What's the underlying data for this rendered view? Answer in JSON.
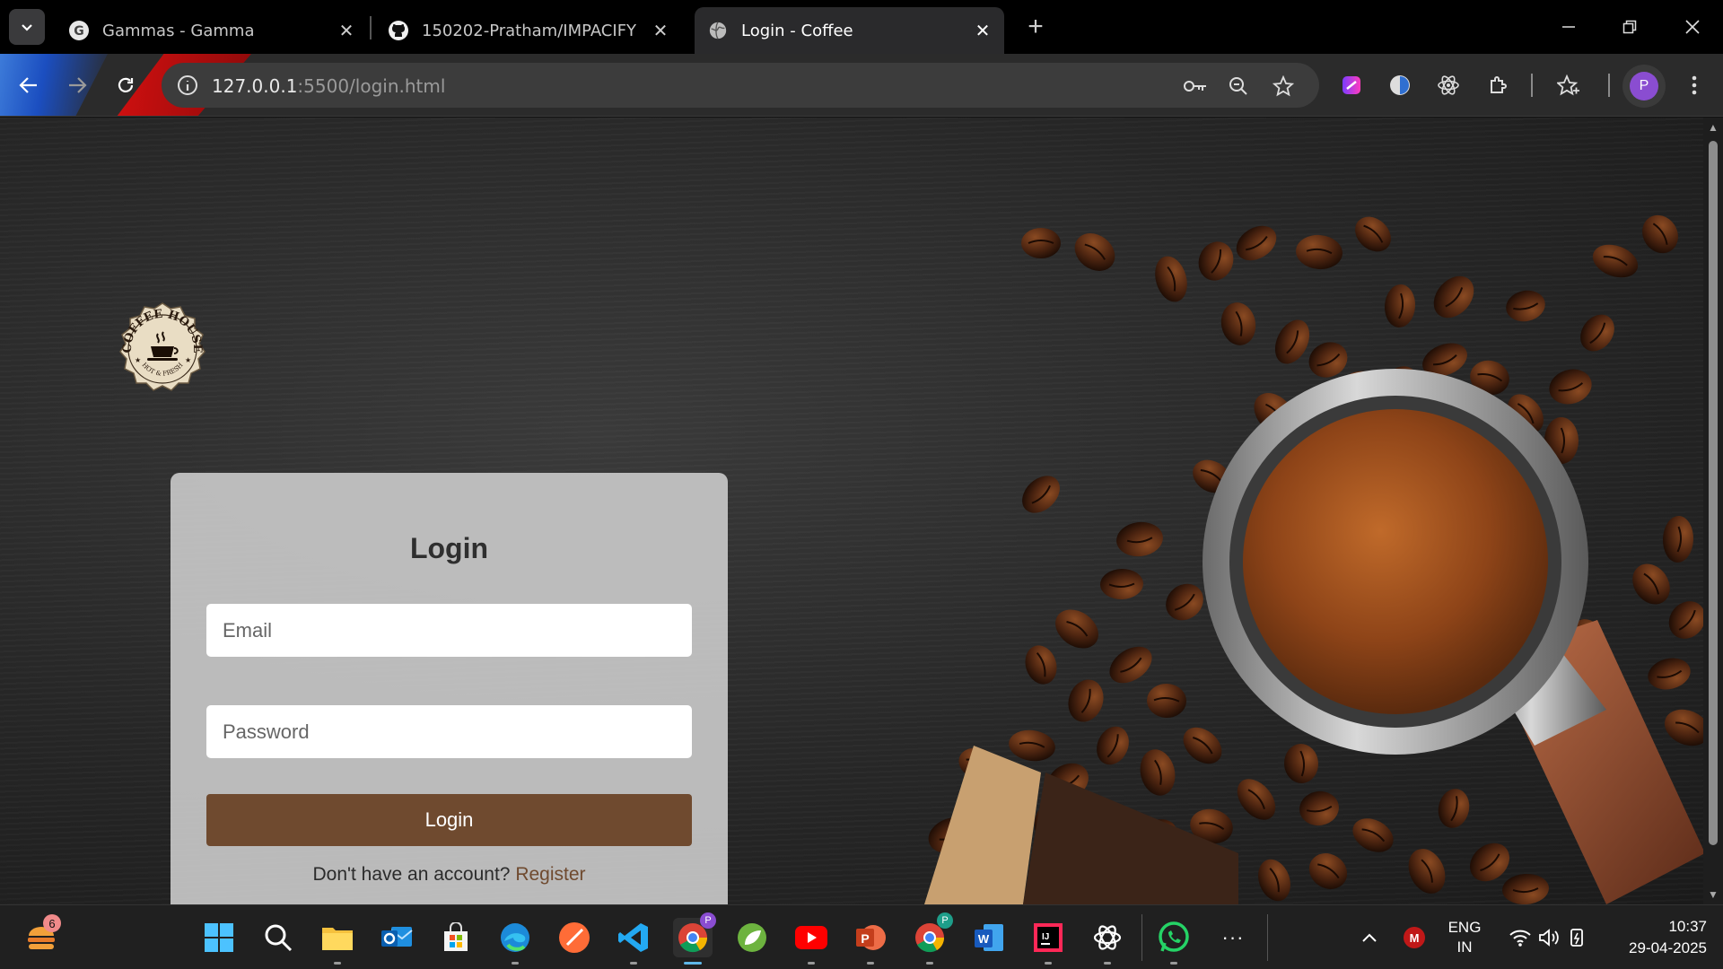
{
  "browser": {
    "tabs": [
      {
        "title": "Gammas - Gamma",
        "icon": "gamma-g-icon"
      },
      {
        "title": "150202-Pratham/IMPACIFY",
        "icon": "github-icon"
      },
      {
        "title": "Login - Coffee",
        "icon": "globe-icon",
        "active": true
      }
    ],
    "url_host": "127.0.0.1",
    "url_path": ":5500/login.html",
    "profile_initial": "P"
  },
  "page": {
    "logo_top_text": "COFFEE HOUSE",
    "logo_bottom_text": "HOT & FRESH",
    "login_title": "Login",
    "email_placeholder": "Email",
    "password_placeholder": "Password",
    "login_button": "Login",
    "signup_prompt": "Don't have an account?",
    "register_link": "Register",
    "colors": {
      "button": "#6f4a2f",
      "card": "#c8c8c8"
    }
  },
  "taskbar": {
    "weather_badge": "6",
    "language_top": "ENG",
    "language_bottom": "IN",
    "time": "10:37",
    "date": "29-04-2025",
    "overflow": "···"
  }
}
